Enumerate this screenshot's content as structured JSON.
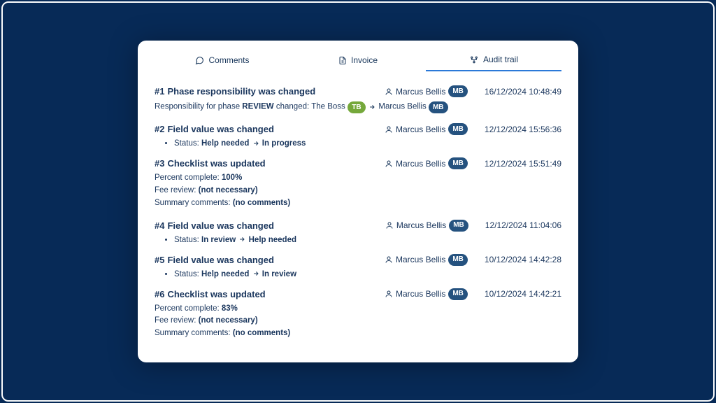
{
  "tabs": {
    "comments": "Comments",
    "invoice": "Invoice",
    "audit": "Audit trail"
  },
  "entries": [
    {
      "idx": "#1",
      "title": "Phase responsibility was changed",
      "user": "Marcus Bellis",
      "user_initials": "MB",
      "datetime": "16/12/2024 10:48:49",
      "phase_detail": {
        "lead": "Responsibility for phase ",
        "phase": "REVIEW",
        "changed": " changed: ",
        "from_name": "The Boss",
        "from_initials": "TB",
        "to_name": "Marcus Bellis",
        "to_initials": "MB"
      }
    },
    {
      "idx": "#2",
      "title": "Field value was changed",
      "user": "Marcus Bellis",
      "user_initials": "MB",
      "datetime": "12/12/2024 15:56:36",
      "status_change": {
        "label": "Status: ",
        "from": "Help needed",
        "to": "In progress"
      }
    },
    {
      "idx": "#3",
      "title": "Checklist was updated",
      "user": "Marcus Bellis",
      "user_initials": "MB",
      "datetime": "12/12/2024 15:51:49",
      "checklist": {
        "percent_label": "Percent complete: ",
        "percent_value": "100%",
        "fee_label": "Fee review: ",
        "fee_value": "(not necessary)",
        "summary_label": "Summary comments: ",
        "summary_value": "(no comments)"
      }
    },
    {
      "idx": "#4",
      "title": "Field value was changed",
      "user": "Marcus Bellis",
      "user_initials": "MB",
      "datetime": "12/12/2024 11:04:06",
      "status_change": {
        "label": "Status: ",
        "from": "In review",
        "to": "Help needed"
      }
    },
    {
      "idx": "#5",
      "title": "Field value was changed",
      "user": "Marcus Bellis",
      "user_initials": "MB",
      "datetime": "10/12/2024 14:42:28",
      "status_change": {
        "label": "Status: ",
        "from": "Help needed",
        "to": "In review"
      }
    },
    {
      "idx": "#6",
      "title": "Checklist was updated",
      "user": "Marcus Bellis",
      "user_initials": "MB",
      "datetime": "10/12/2024 14:42:21",
      "checklist": {
        "percent_label": "Percent complete: ",
        "percent_value": "83%",
        "fee_label": "Fee review: ",
        "fee_value": "(not necessary)",
        "summary_label": "Summary comments: ",
        "summary_value": "(no comments)"
      }
    }
  ]
}
